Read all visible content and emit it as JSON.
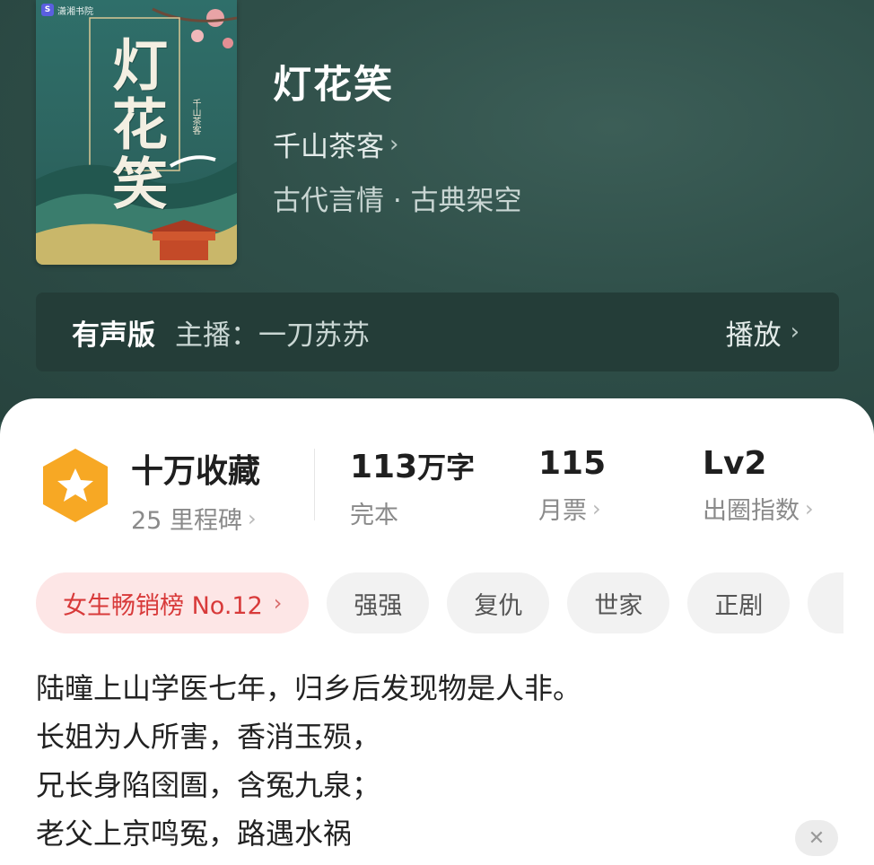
{
  "book": {
    "cover": {
      "publisher": "潇湘书院",
      "publisher_badge": "S",
      "title_art": "灯花笑",
      "author_art": "千山茶客"
    },
    "title": "灯花笑",
    "author": "千山茶客",
    "genre": "古代言情 · 古典架空"
  },
  "audio": {
    "label": "有声版",
    "host": "主播：一刀苏苏",
    "play_label": "播放"
  },
  "stats": {
    "favorites": {
      "value": "十万收藏",
      "sub": "25 里程碑"
    },
    "words": {
      "value": "113",
      "unit": "万字",
      "sub": "完本"
    },
    "monthly_tickets": {
      "value": "115",
      "sub": "月票"
    },
    "influence": {
      "value": "Lv2",
      "sub": "出圈指数"
    }
  },
  "tags": {
    "rank": "女生畅销榜 No.12",
    "items": [
      "强强",
      "复仇",
      "世家",
      "正剧"
    ]
  },
  "description": {
    "lines": [
      "陆曈上山学医七年，归乡后发现物是人非。",
      "长姐为人所害，香消玉殒，",
      "兄长身陷囹圄，含冤九泉；",
      "老父上京鸣冤，路遇水祸"
    ]
  },
  "colors": {
    "header_bg": "#2f4e48",
    "audio_bar_bg": "#243d38",
    "rank_tag_bg": "#fde6e6",
    "rank_tag_text": "#d83a3a",
    "badge_orange": "#f7a824"
  }
}
